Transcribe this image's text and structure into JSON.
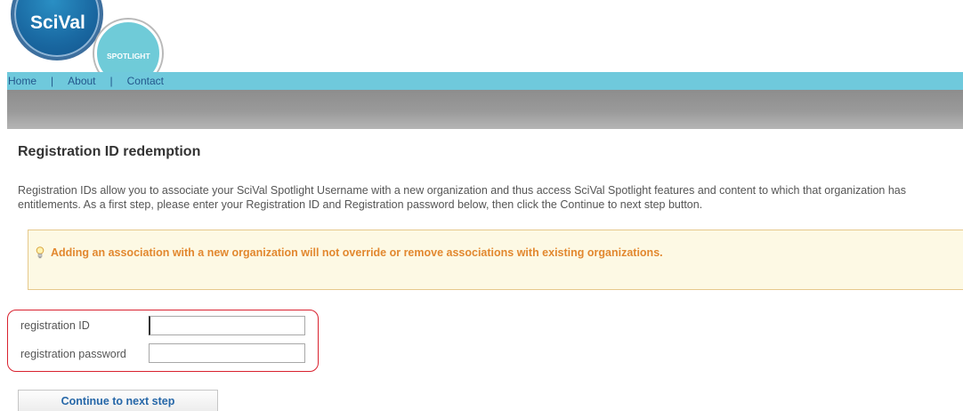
{
  "logo": {
    "brand": "SciVal",
    "subbrand": "SPOTLIGHT"
  },
  "nav": {
    "items": [
      "Home",
      "About",
      "Contact"
    ],
    "separator": "|"
  },
  "page": {
    "title": "Registration ID redemption",
    "description": "Registration IDs allow you to associate your SciVal Spotlight Username with a new organization and thus access SciVal Spotlight features and content to which that organization has entitlements. As a first step, please enter your Registration ID and Registration password below, then click the Continue to next step button."
  },
  "notice": {
    "icon": "lightbulb-icon",
    "message": "Adding an association with a new organization will not override or remove associations with existing organizations."
  },
  "form": {
    "registration_id_label": "registration ID",
    "registration_id_value": "",
    "registration_password_label": "registration password",
    "registration_password_value": ""
  },
  "actions": {
    "continue_label": "Continue to next step"
  },
  "colors": {
    "nav_bg": "#6fc9dc",
    "notice_text": "#e2882f",
    "highlight_border": "#d9222f",
    "link": "#23578c"
  }
}
